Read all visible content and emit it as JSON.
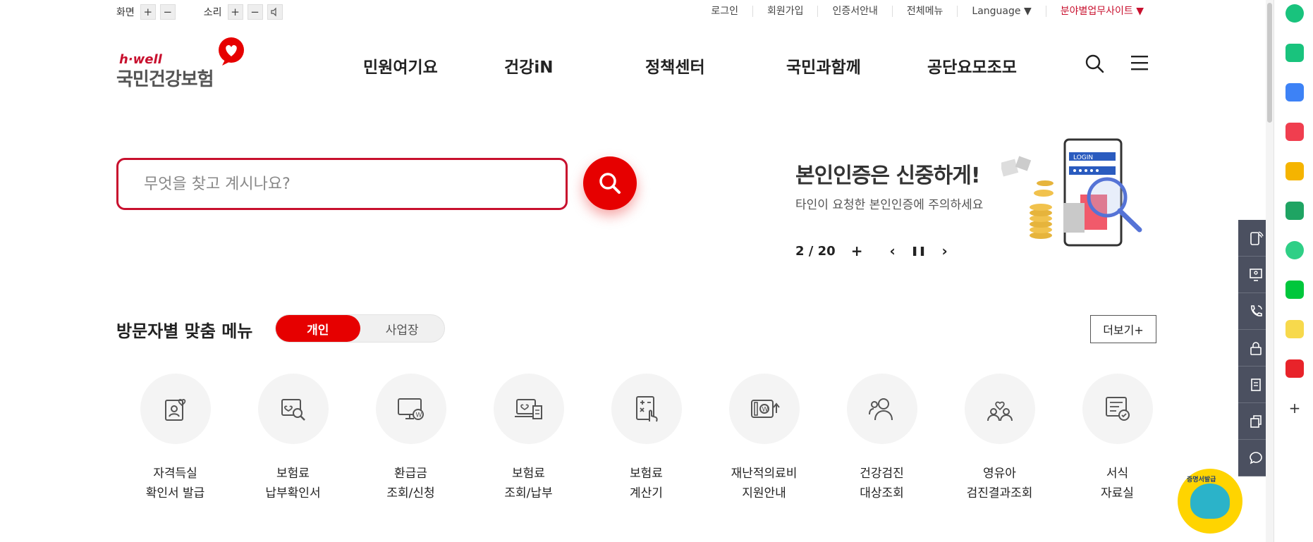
{
  "utility": {
    "screen_label": "화면",
    "sound_label": "소리",
    "plus": "+",
    "minus": "−",
    "links": [
      "로그인",
      "회원가입",
      "인증서안내",
      "전체메뉴",
      "Language ▼"
    ],
    "business_site": "분야별업무사이트 ▼"
  },
  "logo": {
    "tagline": "h·well",
    "name": "국민건강보험"
  },
  "gnb": [
    "민원여기요",
    "건강iN",
    "정책센터",
    "국민과함께",
    "공단요모조모"
  ],
  "search": {
    "placeholder": "무엇을 찾고 계시나요?"
  },
  "banner": {
    "title": "본인인증은 신중하게!",
    "subtitle": "타인이 요청한 본인인증에 주의하세요",
    "page": "2 / 20",
    "plus": "+",
    "prev": "‹",
    "pause": "❚❚",
    "next": "›",
    "image_text": "LOGIN"
  },
  "visitor": {
    "title": "방문자별 맞춤 메뉴",
    "tabs": [
      "개인",
      "사업장"
    ],
    "active_tab": "개인",
    "more": "더보기+"
  },
  "menu": [
    {
      "l1": "자격득실",
      "l2": "확인서 발급",
      "icon": "id-card-heart-icon"
    },
    {
      "l1": "보험료",
      "l2": "납부확인서",
      "icon": "photo-search-icon"
    },
    {
      "l1": "환급금",
      "l2": "조회/신청",
      "icon": "monitor-won-icon"
    },
    {
      "l1": "보험료",
      "l2": "조회/납부",
      "icon": "laptop-receipt-icon"
    },
    {
      "l1": "보험료",
      "l2": "계산기",
      "icon": "calculator-hand-icon"
    },
    {
      "l1": "재난적의료비",
      "l2": "지원안내",
      "icon": "wallet-won-up-icon"
    },
    {
      "l1": "건강검진",
      "l2": "대상조회",
      "icon": "people-search-icon"
    },
    {
      "l1": "영유아",
      "l2": "검진결과조회",
      "icon": "family-heart-icon"
    },
    {
      "l1": "서식",
      "l2": "자료실",
      "icon": "document-check-icon"
    }
  ],
  "chatbot": {
    "label": "증명서발급"
  },
  "colors": {
    "accent": "#e60000",
    "brand": "#c8102e",
    "quick_bar": "#4b5060"
  }
}
